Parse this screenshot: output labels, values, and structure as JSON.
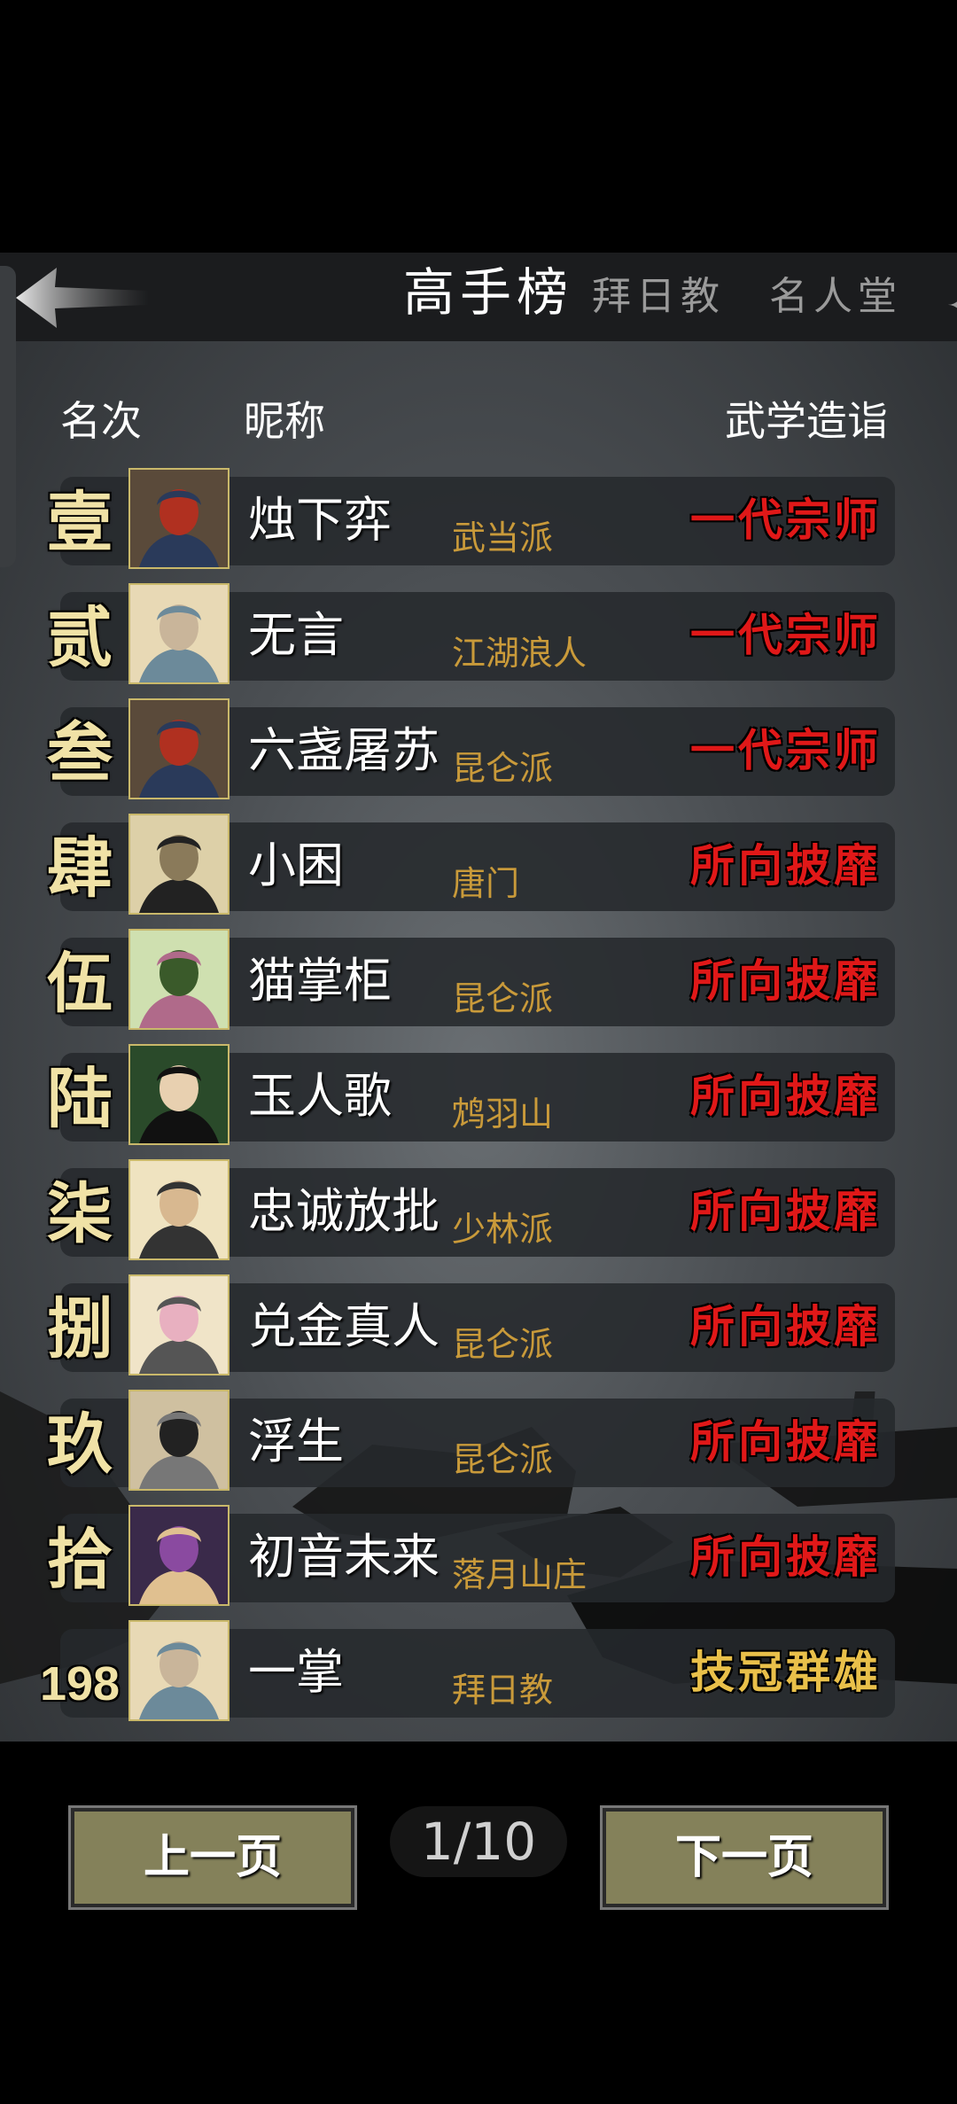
{
  "tabs": [
    {
      "label": "高手榜",
      "active": true
    },
    {
      "label": "拜日教",
      "active": false
    },
    {
      "label": "名人堂",
      "active": false
    }
  ],
  "columns": {
    "rank": "名次",
    "nickname": "昵称",
    "level": "武学造诣"
  },
  "rows": [
    {
      "rank": "壹",
      "name": "烛下弈",
      "sect": "武当派",
      "title": "一代宗师",
      "title_color": "#e01818",
      "avatar": "masked-warrior-icon"
    },
    {
      "rank": "贰",
      "name": "无言",
      "sect": "江湖浪人",
      "title": "一代宗师",
      "title_color": "#e01818",
      "avatar": "woman-portrait-icon"
    },
    {
      "rank": "叁",
      "name": "六盏屠苏",
      "sect": "昆仑派",
      "title": "一代宗师",
      "title_color": "#e01818",
      "avatar": "masked-warrior-icon"
    },
    {
      "rank": "肆",
      "name": "小困",
      "sect": "唐门",
      "title": "所向披靡",
      "title_color": "#e01818",
      "avatar": "elder-taiji-icon"
    },
    {
      "rank": "伍",
      "name": "猫掌柜",
      "sect": "昆仑派",
      "title": "所向披靡",
      "title_color": "#e01818",
      "avatar": "lady-bamboo-icon"
    },
    {
      "rank": "陆",
      "name": "玉人歌",
      "sect": "鸩羽山",
      "title": "所向披靡",
      "title_color": "#e01818",
      "avatar": "dark-hair-man-icon"
    },
    {
      "rank": "柒",
      "name": "忠诚放批",
      "sect": "少林派",
      "title": "所向披靡",
      "title_color": "#e01818",
      "avatar": "bald-man-icon"
    },
    {
      "rank": "捌",
      "name": "兑金真人",
      "sect": "昆仑派",
      "title": "所向披靡",
      "title_color": "#e01818",
      "avatar": "pink-hair-girl-icon"
    },
    {
      "rank": "玖",
      "name": "浮生",
      "sect": "昆仑派",
      "title": "所向披靡",
      "title_color": "#e01818",
      "avatar": "bearded-warrior-icon"
    },
    {
      "rank": "拾",
      "name": "初音未来",
      "sect": "落月山庄",
      "title": "所向披靡",
      "title_color": "#e01818",
      "avatar": "purple-lady-icon"
    },
    {
      "rank": "198",
      "name": "一掌",
      "sect": "拜日教",
      "title": "技冠群雄",
      "title_color": "#e9c04a",
      "avatar": "woman-portrait-icon"
    }
  ],
  "pager": {
    "prev": "上一页",
    "next": "下一页",
    "indicator": "1/10"
  }
}
